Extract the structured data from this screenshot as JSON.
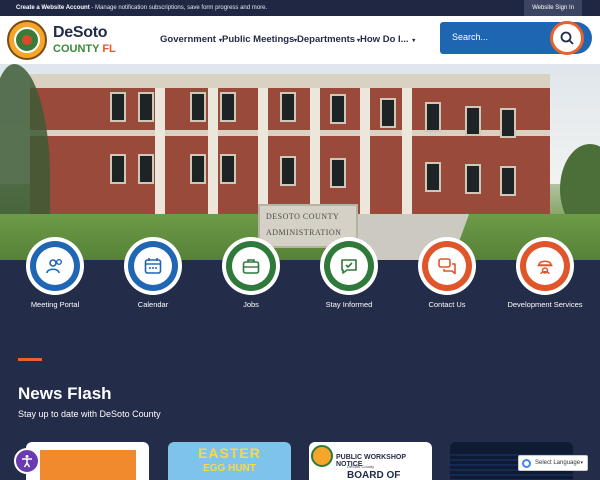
{
  "topbar": {
    "create_bold": "Create a Website Account",
    "create_rest": " - Manage notification subscriptions, save form progress and more.",
    "signin": "Website Sign In"
  },
  "brand": {
    "line1": "DeSoto",
    "line2_county": "COUNTY",
    "line2_state": "FL"
  },
  "nav": {
    "items": [
      {
        "label": "Government",
        "caret": "▾"
      },
      {
        "label": "Public Meetings",
        "caret": "▾"
      },
      {
        "label": "Departments",
        "caret": "▾"
      },
      {
        "label": "How Do I...",
        "caret": "▾"
      }
    ]
  },
  "search": {
    "placeholder": "Search..."
  },
  "hero": {
    "sign_line1": "DESOTO COUNTY",
    "sign_line2": "ADMINISTRATION"
  },
  "quick_links": [
    {
      "label": "Meeting Portal",
      "icon": "people-icon",
      "color": "#1f66b5"
    },
    {
      "label": "Calendar",
      "icon": "calendar-icon",
      "color": "#1f66b5"
    },
    {
      "label": "Jobs",
      "icon": "briefcase-icon",
      "color": "#2f7a3a"
    },
    {
      "label": "Stay Informed",
      "icon": "message-icon",
      "color": "#2f7a3a"
    },
    {
      "label": "Contact Us",
      "icon": "chat-bubbles-icon",
      "color": "#e0552a"
    },
    {
      "label": "Development Services",
      "icon": "hardhat-gear-icon",
      "color": "#e0552a"
    }
  ],
  "news": {
    "title": "News Flash",
    "subtitle": "Stay up to date with DeSoto County",
    "cards": [
      {
        "kind": "orange-graphic"
      },
      {
        "line1": "EASTER",
        "line2": "EGG HUNT"
      },
      {
        "heading": "PUBLIC WORKSHOP NOTICE",
        "sub": "DeSoto County",
        "big": "BOARD OF"
      },
      {
        "kind": "dark-graphic"
      }
    ]
  },
  "language": {
    "label": "Select Language",
    "caret": "▾"
  },
  "colors": {
    "navy": "#232c49",
    "blue": "#1f66b5",
    "green": "#2f7a3a",
    "orange": "#e0552a"
  }
}
